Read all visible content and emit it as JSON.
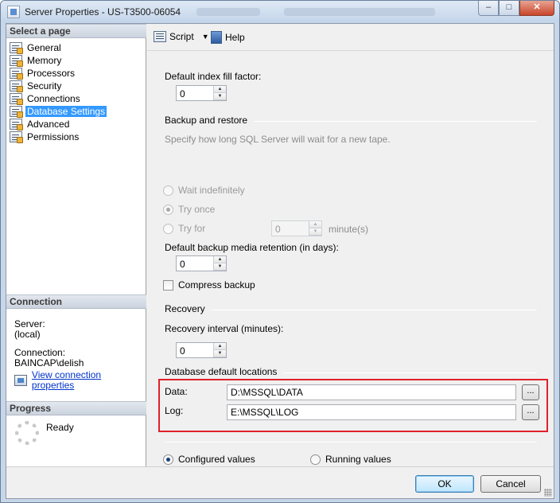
{
  "window": {
    "title": "Server Properties - US-T3500-06054"
  },
  "left": {
    "select_page_header": "Select a page",
    "pages": [
      {
        "label": "General"
      },
      {
        "label": "Memory"
      },
      {
        "label": "Processors"
      },
      {
        "label": "Security"
      },
      {
        "label": "Connections"
      },
      {
        "label": "Database Settings",
        "selected": true
      },
      {
        "label": "Advanced"
      },
      {
        "label": "Permissions"
      }
    ],
    "connection_header": "Connection",
    "server_label": "Server:",
    "server_value": "(local)",
    "connection_label": "Connection:",
    "connection_value": "BAINCAP\\delish",
    "view_props_link": "View connection properties",
    "progress_header": "Progress",
    "progress_status": "Ready"
  },
  "toolbar": {
    "script_label": "Script",
    "help_label": "Help"
  },
  "form": {
    "fill_factor_label": "Default index fill factor:",
    "fill_factor_value": "0",
    "backup_group": "Backup and restore",
    "backup_hint": "Specify how long SQL Server will wait for a new tape.",
    "wait_indef_label": "Wait indefinitely",
    "try_once_label": "Try once",
    "try_for_label": "Try for",
    "try_for_value": "0",
    "minutes_label": "minute(s)",
    "retention_label": "Default backup media retention (in days):",
    "retention_value": "0",
    "compress_label": "Compress backup",
    "recovery_group": "Recovery",
    "recovery_interval_label": "Recovery interval (minutes):",
    "recovery_interval_value": "0",
    "locations_group": "Database default locations",
    "data_label": "Data:",
    "data_value": "D:\\MSSQL\\DATA",
    "log_label": "Log:",
    "log_value": "E:\\MSSQL\\LOG",
    "browse_label": "...",
    "configured_label": "Configured values",
    "running_label": "Running values"
  },
  "buttons": {
    "ok": "OK",
    "cancel": "Cancel"
  },
  "colors": {
    "highlight_box": "#e0212a",
    "selection": "#3399ff",
    "link": "#0033cc"
  }
}
